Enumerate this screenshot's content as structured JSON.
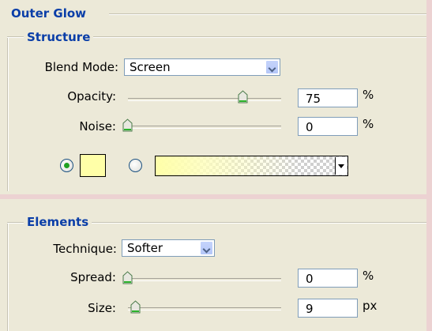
{
  "outer_glow": {
    "title": "Outer Glow",
    "structure": {
      "title": "Structure",
      "blend_mode": {
        "label": "Blend Mode:",
        "value": "Screen"
      },
      "opacity": {
        "label": "Opacity:",
        "value": "75",
        "unit": "%",
        "slider_fraction": 0.75
      },
      "noise": {
        "label": "Noise:",
        "value": "0",
        "unit": "%",
        "slider_fraction": 0
      },
      "color_mode": "solid",
      "solid_color": "#ffffa8",
      "gradient_start": "#ffffa8"
    },
    "elements": {
      "title": "Elements",
      "technique": {
        "label": "Technique:",
        "value": "Softer"
      },
      "spread": {
        "label": "Spread:",
        "value": "0",
        "unit": "%",
        "slider_fraction": 0
      },
      "size": {
        "label": "Size:",
        "value": "9",
        "unit": "px",
        "slider_fraction": 0.05
      }
    }
  },
  "colors": {
    "section_title": "#0a3ea8",
    "radio_selected": "#20a020",
    "panel_bg": "#ece9d8"
  }
}
